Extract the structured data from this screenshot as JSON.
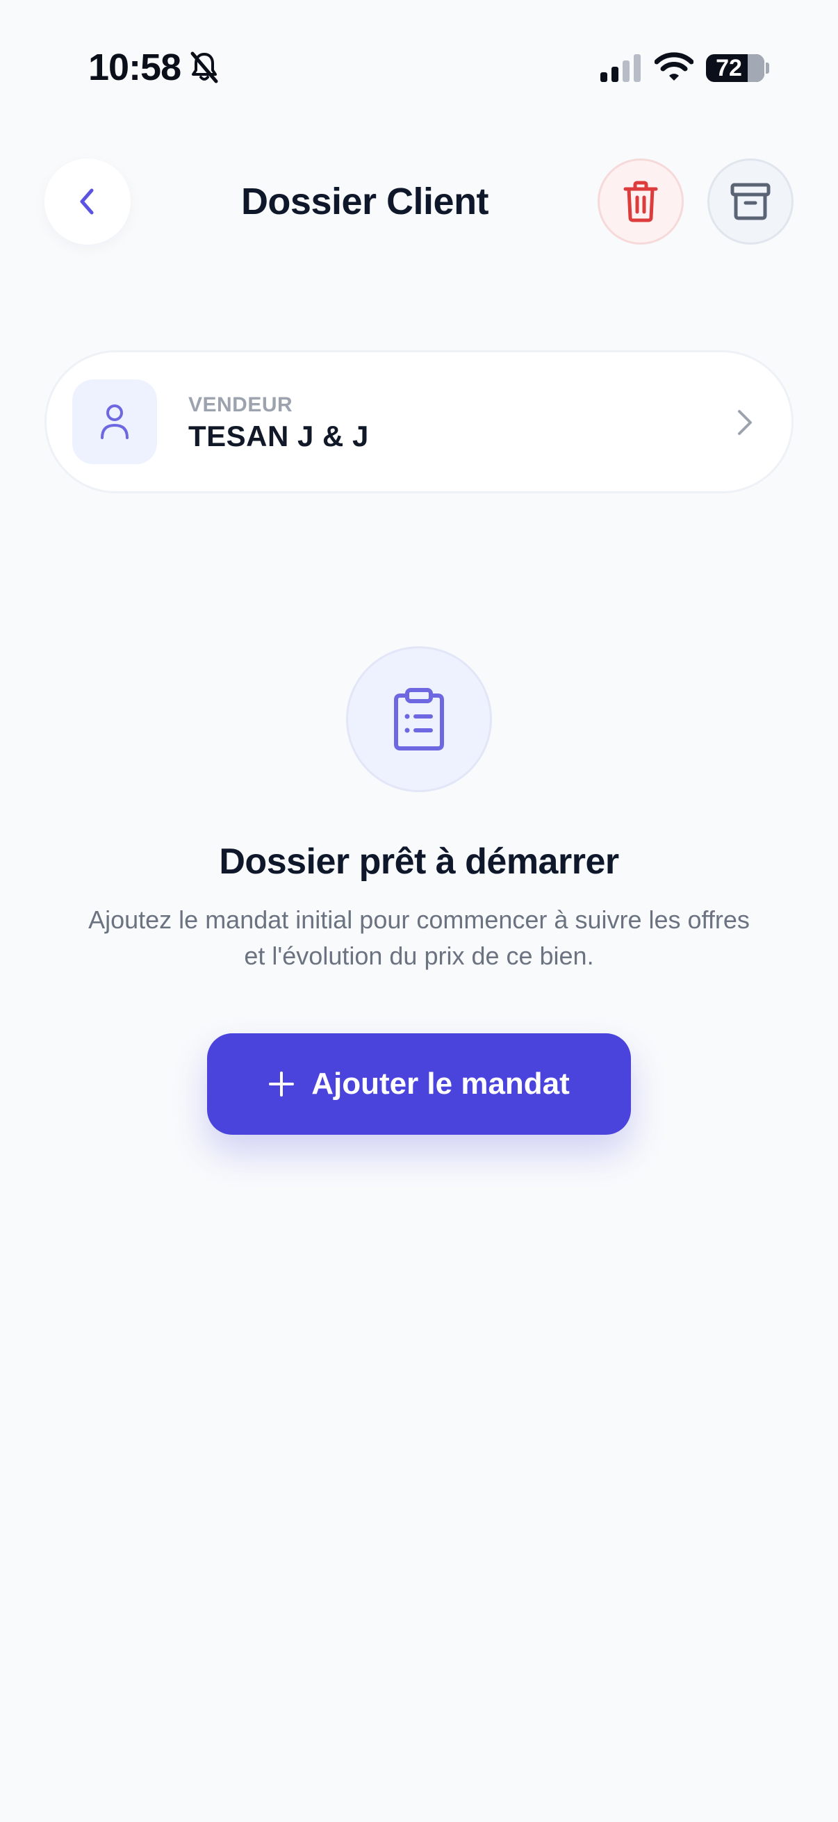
{
  "status_bar": {
    "time": "10:58",
    "battery_level": "72"
  },
  "header": {
    "title": "Dossier Client"
  },
  "seller": {
    "role_label": "VENDEUR",
    "name": "TESAN J & J"
  },
  "empty_state": {
    "title": "Dossier prêt à démarrer",
    "description": "Ajoutez le mandat initial pour commencer à suivre les offres et l'évolution du prix de ce bien."
  },
  "actions": {
    "add_mandate_label": "Ajouter le mandat"
  },
  "icons": {
    "back": "chevron-left-icon",
    "delete": "trash-icon",
    "archive": "archive-box-icon",
    "seller": "user-icon",
    "seller_chevron": "chevron-right-icon",
    "empty": "clipboard-list-icon",
    "add": "plus-icon",
    "muted": "bell-slash-icon"
  },
  "colors": {
    "accent": "#4A44DC",
    "accent_soft": "#EEF2FF",
    "danger": "#DC3C3C",
    "background": "#F8FAFC",
    "text_primary": "#0F172A",
    "text_secondary": "#6B7280"
  }
}
